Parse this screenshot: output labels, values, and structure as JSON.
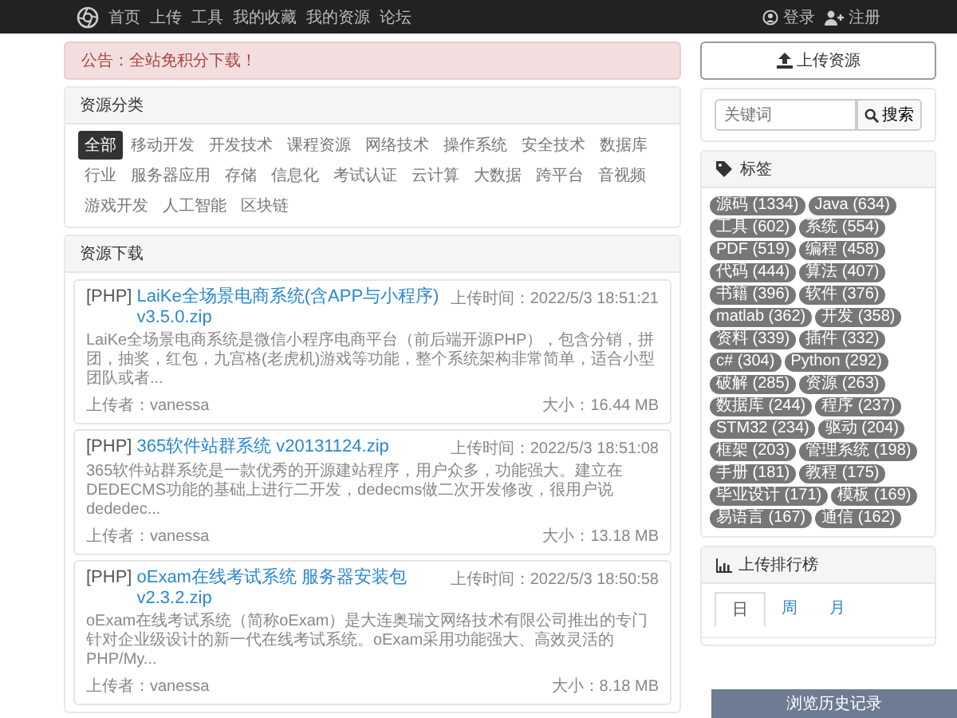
{
  "nav": {
    "items": [
      "首页",
      "上传",
      "工具",
      "我的收藏",
      "我的资源",
      "论坛"
    ],
    "login": "登录",
    "register": "注册"
  },
  "notice": "公告：全站免积分下载！",
  "categories": {
    "title": "资源分类",
    "items": [
      {
        "label": "全部",
        "selected": true
      },
      {
        "label": "移动开发",
        "selected": false
      },
      {
        "label": "开发技术",
        "selected": false
      },
      {
        "label": "课程资源",
        "selected": false
      },
      {
        "label": "网络技术",
        "selected": false
      },
      {
        "label": "操作系统",
        "selected": false
      },
      {
        "label": "安全技术",
        "selected": false
      },
      {
        "label": "数据库",
        "selected": false
      },
      {
        "label": "行业",
        "selected": false
      },
      {
        "label": "服务器应用",
        "selected": false
      },
      {
        "label": "存储",
        "selected": false
      },
      {
        "label": "信息化",
        "selected": false
      },
      {
        "label": "考试认证",
        "selected": false
      },
      {
        "label": "云计算",
        "selected": false
      },
      {
        "label": "大数据",
        "selected": false
      },
      {
        "label": "跨平台",
        "selected": false
      },
      {
        "label": "音视频",
        "selected": false
      },
      {
        "label": "游戏开发",
        "selected": false
      },
      {
        "label": "人工智能",
        "selected": false
      },
      {
        "label": "区块链",
        "selected": false
      }
    ]
  },
  "downloads": {
    "title": "资源下载",
    "items": [
      {
        "lang": "[PHP]",
        "title": "LaiKe全场景电商系统(含APP与小程序) v3.5.0.zip",
        "time": "上传时间：2022/5/3 18:51:21",
        "desc": "LaiKe全场景电商系统是微信小程序电商平台（前后端开源PHP），包含分销，拼团，抽奖，红包，九宫格(老虎机)游戏等功能，整个系统架构非常简单，适合小型团队或者...",
        "uploader": "上传者：vanessa",
        "size": "大小：16.44 MB"
      },
      {
        "lang": "[PHP]",
        "title": "365软件站群系统 v20131124.zip",
        "time": "上传时间：2022/5/3 18:51:08",
        "desc": "365软件站群系统是一款优秀的开源建站程序，用户众多，功能强大。建立在DEDECMS功能的基础上进行二开发，dedecms做二次开发修改，很用户说dededec...",
        "uploader": "上传者：vanessa",
        "size": "大小：13.18 MB"
      },
      {
        "lang": "[PHP]",
        "title": "oExam在线考试系统 服务器安装包 v2.3.2.zip",
        "time": "上传时间：2022/5/3 18:50:58",
        "desc": "oExam在线考试系统（简称oExam）是大连奥瑞文网络技术有限公司推出的专门针对企业级设计的新一代在线考试系统。oExam采用功能强大、高效灵活的PHP/My...",
        "uploader": "上传者：vanessa",
        "size": "大小：8.18 MB"
      }
    ]
  },
  "upload_button": "上传资源",
  "search": {
    "placeholder": "关键词",
    "button": "搜索"
  },
  "tags": {
    "title": "标签",
    "items": [
      "源码 (1334)",
      "Java (634)",
      "工具 (602)",
      "系统 (554)",
      "PDF (519)",
      "编程 (458)",
      "代码 (444)",
      "算法 (407)",
      "书籍 (396)",
      "软件 (376)",
      "matlab (362)",
      "开发 (358)",
      "资料 (339)",
      "插件 (332)",
      "c# (304)",
      "Python (292)",
      "破解 (285)",
      "资源 (263)",
      "数据库 (244)",
      "程序 (237)",
      "STM32 (234)",
      "驱动 (204)",
      "框架 (203)",
      "管理系统 (198)",
      "手册 (181)",
      "教程 (175)",
      "毕业设计 (171)",
      "模板 (169)",
      "易语言 (167)",
      "通信 (162)"
    ]
  },
  "ranking": {
    "title": "上传排行榜",
    "tabs": [
      {
        "label": "日",
        "selected": true
      },
      {
        "label": "周",
        "selected": false
      },
      {
        "label": "月",
        "selected": false
      }
    ]
  },
  "history_button": "浏览历史记录"
}
